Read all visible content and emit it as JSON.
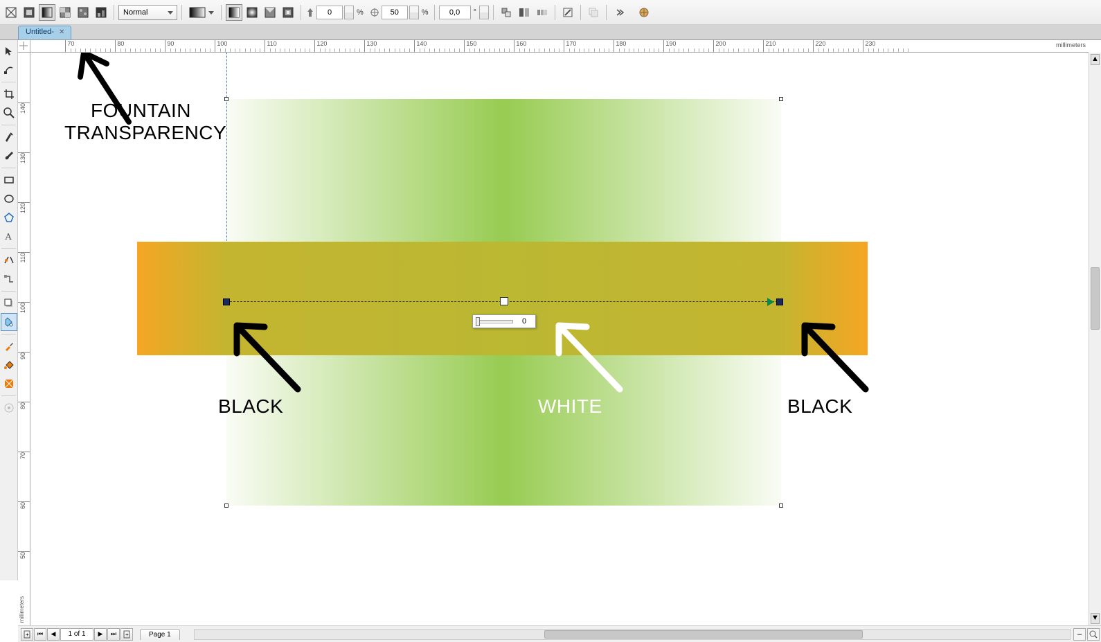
{
  "toolbar": {
    "mode_label": "Normal",
    "opacity_start": "0",
    "opacity_mid": "50",
    "angle": "0,0",
    "angle_unit": "°",
    "percent": "%",
    "plus": "+"
  },
  "document": {
    "tab_title": "Untitled-"
  },
  "ruler": {
    "units_h": "millimeters",
    "units_v": "millimeters",
    "h_ticks": [
      70,
      80,
      90,
      100,
      110,
      120,
      130,
      140,
      150,
      160,
      170,
      180,
      190,
      200,
      210,
      220,
      230
    ],
    "v_ticks": [
      140,
      130,
      120,
      110,
      100,
      90,
      80,
      70,
      60,
      50
    ]
  },
  "transparency": {
    "slider_value": "0"
  },
  "annotations": {
    "fountain": "FOUNTAIN",
    "transparency": "TRANSPARENCY",
    "black1": "BLACK",
    "white": "WHITE",
    "black2": "BLACK"
  },
  "page_nav": {
    "counter": "1 of 1",
    "page_tab": "Page 1"
  }
}
